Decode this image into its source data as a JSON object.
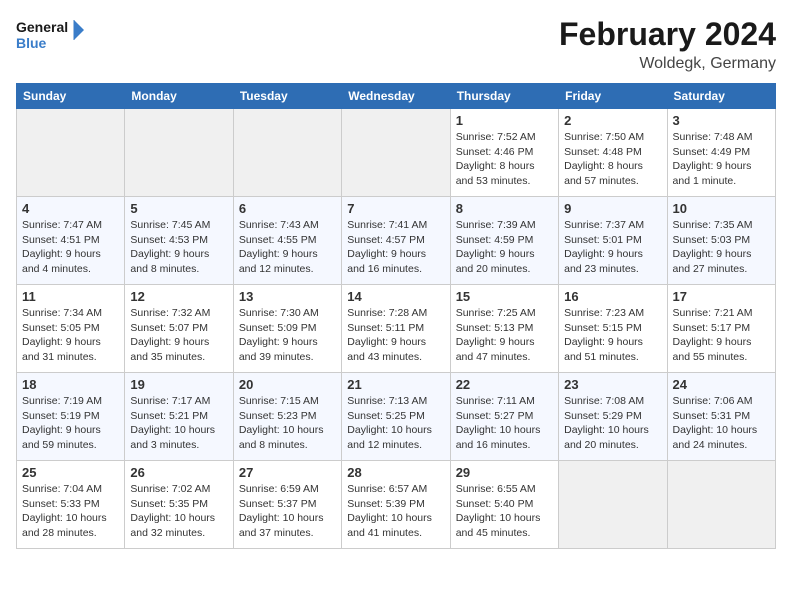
{
  "header": {
    "logo_line1": "General",
    "logo_line2": "Blue",
    "title": "February 2024",
    "subtitle": "Woldegk, Germany"
  },
  "weekdays": [
    "Sunday",
    "Monday",
    "Tuesday",
    "Wednesday",
    "Thursday",
    "Friday",
    "Saturday"
  ],
  "weeks": [
    [
      {
        "day": "",
        "info": ""
      },
      {
        "day": "",
        "info": ""
      },
      {
        "day": "",
        "info": ""
      },
      {
        "day": "",
        "info": ""
      },
      {
        "day": "1",
        "info": "Sunrise: 7:52 AM\nSunset: 4:46 PM\nDaylight: 8 hours\nand 53 minutes."
      },
      {
        "day": "2",
        "info": "Sunrise: 7:50 AM\nSunset: 4:48 PM\nDaylight: 8 hours\nand 57 minutes."
      },
      {
        "day": "3",
        "info": "Sunrise: 7:48 AM\nSunset: 4:49 PM\nDaylight: 9 hours\nand 1 minute."
      }
    ],
    [
      {
        "day": "4",
        "info": "Sunrise: 7:47 AM\nSunset: 4:51 PM\nDaylight: 9 hours\nand 4 minutes."
      },
      {
        "day": "5",
        "info": "Sunrise: 7:45 AM\nSunset: 4:53 PM\nDaylight: 9 hours\nand 8 minutes."
      },
      {
        "day": "6",
        "info": "Sunrise: 7:43 AM\nSunset: 4:55 PM\nDaylight: 9 hours\nand 12 minutes."
      },
      {
        "day": "7",
        "info": "Sunrise: 7:41 AM\nSunset: 4:57 PM\nDaylight: 9 hours\nand 16 minutes."
      },
      {
        "day": "8",
        "info": "Sunrise: 7:39 AM\nSunset: 4:59 PM\nDaylight: 9 hours\nand 20 minutes."
      },
      {
        "day": "9",
        "info": "Sunrise: 7:37 AM\nSunset: 5:01 PM\nDaylight: 9 hours\nand 23 minutes."
      },
      {
        "day": "10",
        "info": "Sunrise: 7:35 AM\nSunset: 5:03 PM\nDaylight: 9 hours\nand 27 minutes."
      }
    ],
    [
      {
        "day": "11",
        "info": "Sunrise: 7:34 AM\nSunset: 5:05 PM\nDaylight: 9 hours\nand 31 minutes."
      },
      {
        "day": "12",
        "info": "Sunrise: 7:32 AM\nSunset: 5:07 PM\nDaylight: 9 hours\nand 35 minutes."
      },
      {
        "day": "13",
        "info": "Sunrise: 7:30 AM\nSunset: 5:09 PM\nDaylight: 9 hours\nand 39 minutes."
      },
      {
        "day": "14",
        "info": "Sunrise: 7:28 AM\nSunset: 5:11 PM\nDaylight: 9 hours\nand 43 minutes."
      },
      {
        "day": "15",
        "info": "Sunrise: 7:25 AM\nSunset: 5:13 PM\nDaylight: 9 hours\nand 47 minutes."
      },
      {
        "day": "16",
        "info": "Sunrise: 7:23 AM\nSunset: 5:15 PM\nDaylight: 9 hours\nand 51 minutes."
      },
      {
        "day": "17",
        "info": "Sunrise: 7:21 AM\nSunset: 5:17 PM\nDaylight: 9 hours\nand 55 minutes."
      }
    ],
    [
      {
        "day": "18",
        "info": "Sunrise: 7:19 AM\nSunset: 5:19 PM\nDaylight: 9 hours\nand 59 minutes."
      },
      {
        "day": "19",
        "info": "Sunrise: 7:17 AM\nSunset: 5:21 PM\nDaylight: 10 hours\nand 3 minutes."
      },
      {
        "day": "20",
        "info": "Sunrise: 7:15 AM\nSunset: 5:23 PM\nDaylight: 10 hours\nand 8 minutes."
      },
      {
        "day": "21",
        "info": "Sunrise: 7:13 AM\nSunset: 5:25 PM\nDaylight: 10 hours\nand 12 minutes."
      },
      {
        "day": "22",
        "info": "Sunrise: 7:11 AM\nSunset: 5:27 PM\nDaylight: 10 hours\nand 16 minutes."
      },
      {
        "day": "23",
        "info": "Sunrise: 7:08 AM\nSunset: 5:29 PM\nDaylight: 10 hours\nand 20 minutes."
      },
      {
        "day": "24",
        "info": "Sunrise: 7:06 AM\nSunset: 5:31 PM\nDaylight: 10 hours\nand 24 minutes."
      }
    ],
    [
      {
        "day": "25",
        "info": "Sunrise: 7:04 AM\nSunset: 5:33 PM\nDaylight: 10 hours\nand 28 minutes."
      },
      {
        "day": "26",
        "info": "Sunrise: 7:02 AM\nSunset: 5:35 PM\nDaylight: 10 hours\nand 32 minutes."
      },
      {
        "day": "27",
        "info": "Sunrise: 6:59 AM\nSunset: 5:37 PM\nDaylight: 10 hours\nand 37 minutes."
      },
      {
        "day": "28",
        "info": "Sunrise: 6:57 AM\nSunset: 5:39 PM\nDaylight: 10 hours\nand 41 minutes."
      },
      {
        "day": "29",
        "info": "Sunrise: 6:55 AM\nSunset: 5:40 PM\nDaylight: 10 hours\nand 45 minutes."
      },
      {
        "day": "",
        "info": ""
      },
      {
        "day": "",
        "info": ""
      }
    ]
  ]
}
